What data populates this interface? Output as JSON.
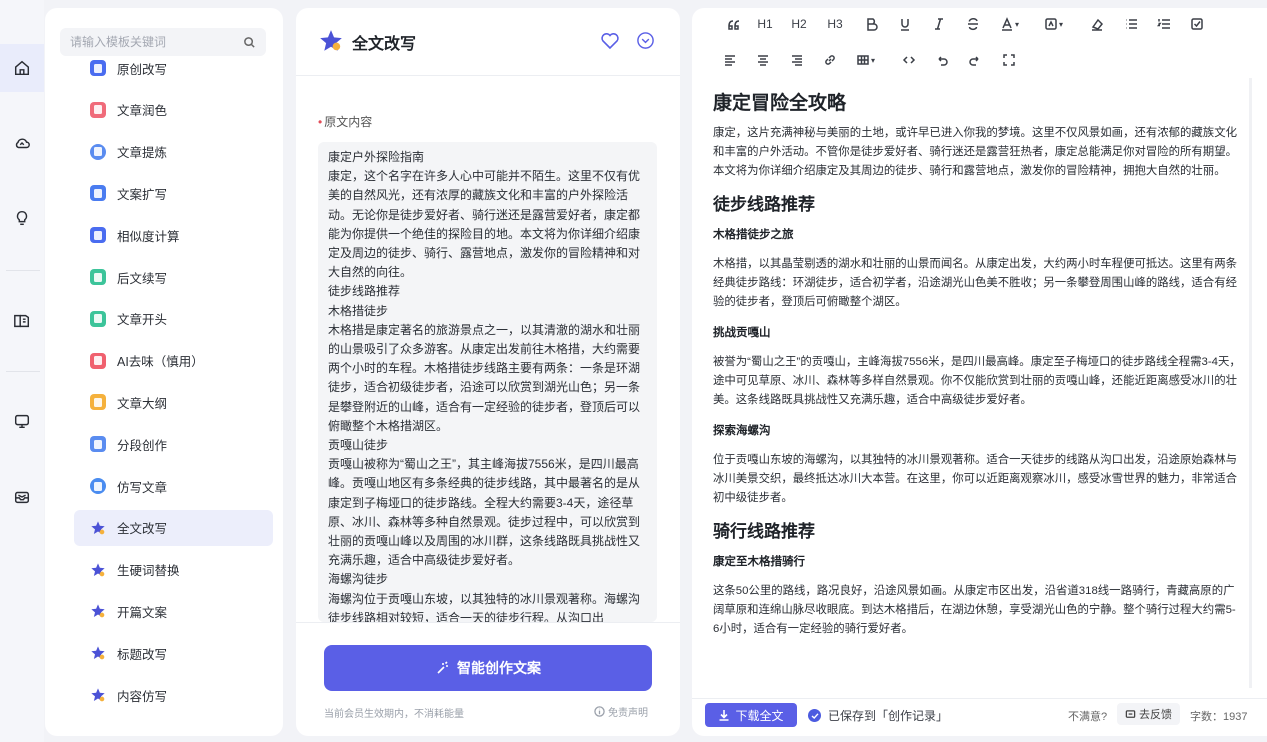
{
  "rail": {
    "items": [
      {
        "icon": "home-icon",
        "active": true
      },
      {
        "icon": "cloud-icon",
        "active": false
      },
      {
        "icon": "lightbulb-icon",
        "active": false
      },
      {
        "icon": "book-icon",
        "active": false
      },
      {
        "icon": "monitor-icon",
        "active": false
      },
      {
        "icon": "inbox-icon",
        "active": false
      }
    ]
  },
  "templates": {
    "search_placeholder": "请输入模板关键词",
    "items": [
      {
        "label": "原创改写",
        "color": "#4a6cf0"
      },
      {
        "label": "文章润色",
        "color": "#f06b7a"
      },
      {
        "label": "文章提炼",
        "color": "#5a8cf0"
      },
      {
        "label": "文案扩写",
        "color": "#4a7cf0"
      },
      {
        "label": "相似度计算",
        "color": "#4a6cf0"
      },
      {
        "label": "后文续写",
        "color": "#3cc49a"
      },
      {
        "label": "文章开头",
        "color": "#3cc49a"
      },
      {
        "label": "AI去味（慎用）",
        "color": "#f0606e"
      },
      {
        "label": "文章大纲",
        "color": "#f5b13c"
      },
      {
        "label": "分段创作",
        "color": "#5a8cf0"
      },
      {
        "label": "仿写文章",
        "color": "#4a8cf0"
      },
      {
        "label": "全文改写",
        "color": "#4b52d6",
        "active": true
      },
      {
        "label": "生硬词替换",
        "color": "#4b52d6"
      },
      {
        "label": "开篇文案",
        "color": "#4b52d6"
      },
      {
        "label": "标题改写",
        "color": "#4b52d6"
      },
      {
        "label": "内容仿写",
        "color": "#4b52d6"
      }
    ]
  },
  "middle": {
    "title": "全文改写",
    "field_label": "原文内容",
    "required_mark": "•",
    "source_text": "康定户外探险指南\n康定，这个名字在许多人心中可能并不陌生。这里不仅有优美的自然风光，还有浓厚的藏族文化和丰富的户外探险活动。无论你是徒步爱好者、骑行迷还是露营爱好者，康定都能为你提供一个绝佳的探险目的地。本文将为你详细介绍康定及周边的徒步、骑行、露营地点，激发你的冒险精神和对大自然的向往。\n徒步线路推荐\n木格措徒步\n木格措是康定著名的旅游景点之一，以其清澈的湖水和壮丽的山景吸引了众多游客。从康定出发前往木格措，大约需要两个小时的车程。木格措徒步线路主要有两条：一条是环湖徒步，适合初级徒步者，沿途可以欣赏到湖光山色；另一条是攀登附近的山峰，适合有一定经验的徒步者，登顶后可以俯瞰整个木格措湖区。\n贡嘎山徒步\n贡嘎山被称为“蜀山之王”，其主峰海拔7556米，是四川最高峰。贡嘎山地区有多条经典的徒步线路，其中最著名的是从康定到子梅垭口的徒步路线。全程大约需要3-4天，途径草原、冰川、森林等多种自然景观。徒步过程中，可以欣赏到壮丽的贡嘎山峰以及周围的冰川群，这条线路既具挑战性又充满乐趣，适合中高级徒步爱好者。\n海螺沟徒步\n海螺沟位于贡嘎山东坡，以其独特的冰川景观著称。海螺沟徒步线路相对较短，适合一天的徒步行程。从沟口出",
    "generate_button": "智能创作文案",
    "footer_note": "当前会员生效期内，不消耗能量",
    "disclaimer": "免责声明"
  },
  "toolbar": {
    "row1": [
      "quote-icon",
      "H1",
      "H2",
      "H3",
      "bold-icon",
      "underline-icon",
      "italic-icon",
      "strikethrough-icon",
      "font-color-icon",
      "highlight-icon",
      "clear-format-icon",
      "bullet-list-icon",
      "numbered-list-icon",
      "checklist-icon"
    ],
    "row2": [
      "align-left-icon",
      "align-center-icon",
      "align-right-icon",
      "link-icon",
      "table-icon",
      "code-icon",
      "undo-icon",
      "redo-icon",
      "fullscreen-icon"
    ]
  },
  "document": {
    "title": "康定冒险全攻略",
    "intro": "康定，这片充满神秘与美丽的土地，或许早已进入你我的梦境。这里不仅风景如画，还有浓郁的藏族文化和丰富的户外活动。不管你是徒步爱好者、骑行迷还是露营狂热者，康定总能满足你对冒险的所有期望。本文将为你详细介绍康定及其周边的徒步、骑行和露营地点，激发你的冒险精神，拥抱大自然的壮丽。",
    "section1": "徒步线路推荐",
    "sub1": "木格措徒步之旅",
    "sub1_text": "木格措，以其晶莹剔透的湖水和壮丽的山景而闻名。从康定出发，大约两小时车程便可抵达。这里有两条经典徒步路线：环湖徒步，适合初学者，沿途湖光山色美不胜收；另一条攀登周围山峰的路线，适合有经验的徒步者，登顶后可俯瞰整个湖区。",
    "sub2": "挑战贡嘎山",
    "sub2_text": "被誉为“蜀山之王”的贡嘎山，主峰海拔7556米，是四川最高峰。康定至子梅垭口的徒步路线全程需3-4天，途中可见草原、冰川、森林等多样自然景观。你不仅能欣赏到壮丽的贡嘎山峰，还能近距离感受冰川的壮美。这条线路既具挑战性又充满乐趣，适合中高级徒步爱好者。",
    "sub3": "探索海螺沟",
    "sub3_text": "位于贡嘎山东坡的海螺沟，以其独特的冰川景观著称。适合一天徒步的线路从沟口出发，沿途原始森林与冰川美景交织，最终抵达冰川大本营。在这里，你可以近距离观察冰川，感受冰雪世界的魅力，非常适合初中级徒步者。",
    "section2": "骑行线路推荐",
    "sub4": "康定至木格措骑行",
    "sub4_text": "这条50公里的路线，路况良好，沿途风景如画。从康定市区出发，沿省道318线一路骑行，青藏高原的广阔草原和连绵山脉尽收眼底。到达木格措后，在湖边休憩，享受湖光山色的宁静。整个骑行过程大约需5-6小时，适合有一定经验的骑行爱好者。"
  },
  "footer": {
    "download": "下载全文",
    "saved_to": "已保存到「创作记录」",
    "unsatisfied": "不满意?",
    "feedback": "去反馈",
    "word_count_label": "字数：",
    "word_count": "1937"
  }
}
